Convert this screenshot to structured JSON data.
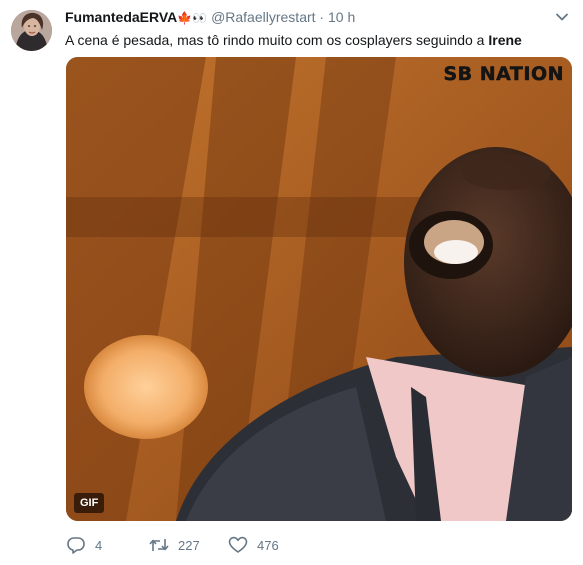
{
  "tweet": {
    "author_name": "FumantedaERVA",
    "author_emojis": "🍁👀",
    "handle": "@Rafaellyrestart",
    "separator": "·",
    "time": "10 h",
    "text_before": "A cena é pesada, mas tô rindo muito com os cosplayers seguindo a ",
    "text_mention": "Irene",
    "media": {
      "badge": "GIF",
      "watermark": "SB NATION"
    },
    "actions": {
      "reply_count": "4",
      "retweet_count": "227",
      "like_count": "476"
    }
  },
  "colors": {
    "text": "#14171a",
    "secondary": "#657786",
    "media_background": "#a0531b"
  },
  "icons": [
    "avatar",
    "chevron-down-icon",
    "reply-icon",
    "retweet-icon",
    "like-icon"
  ]
}
